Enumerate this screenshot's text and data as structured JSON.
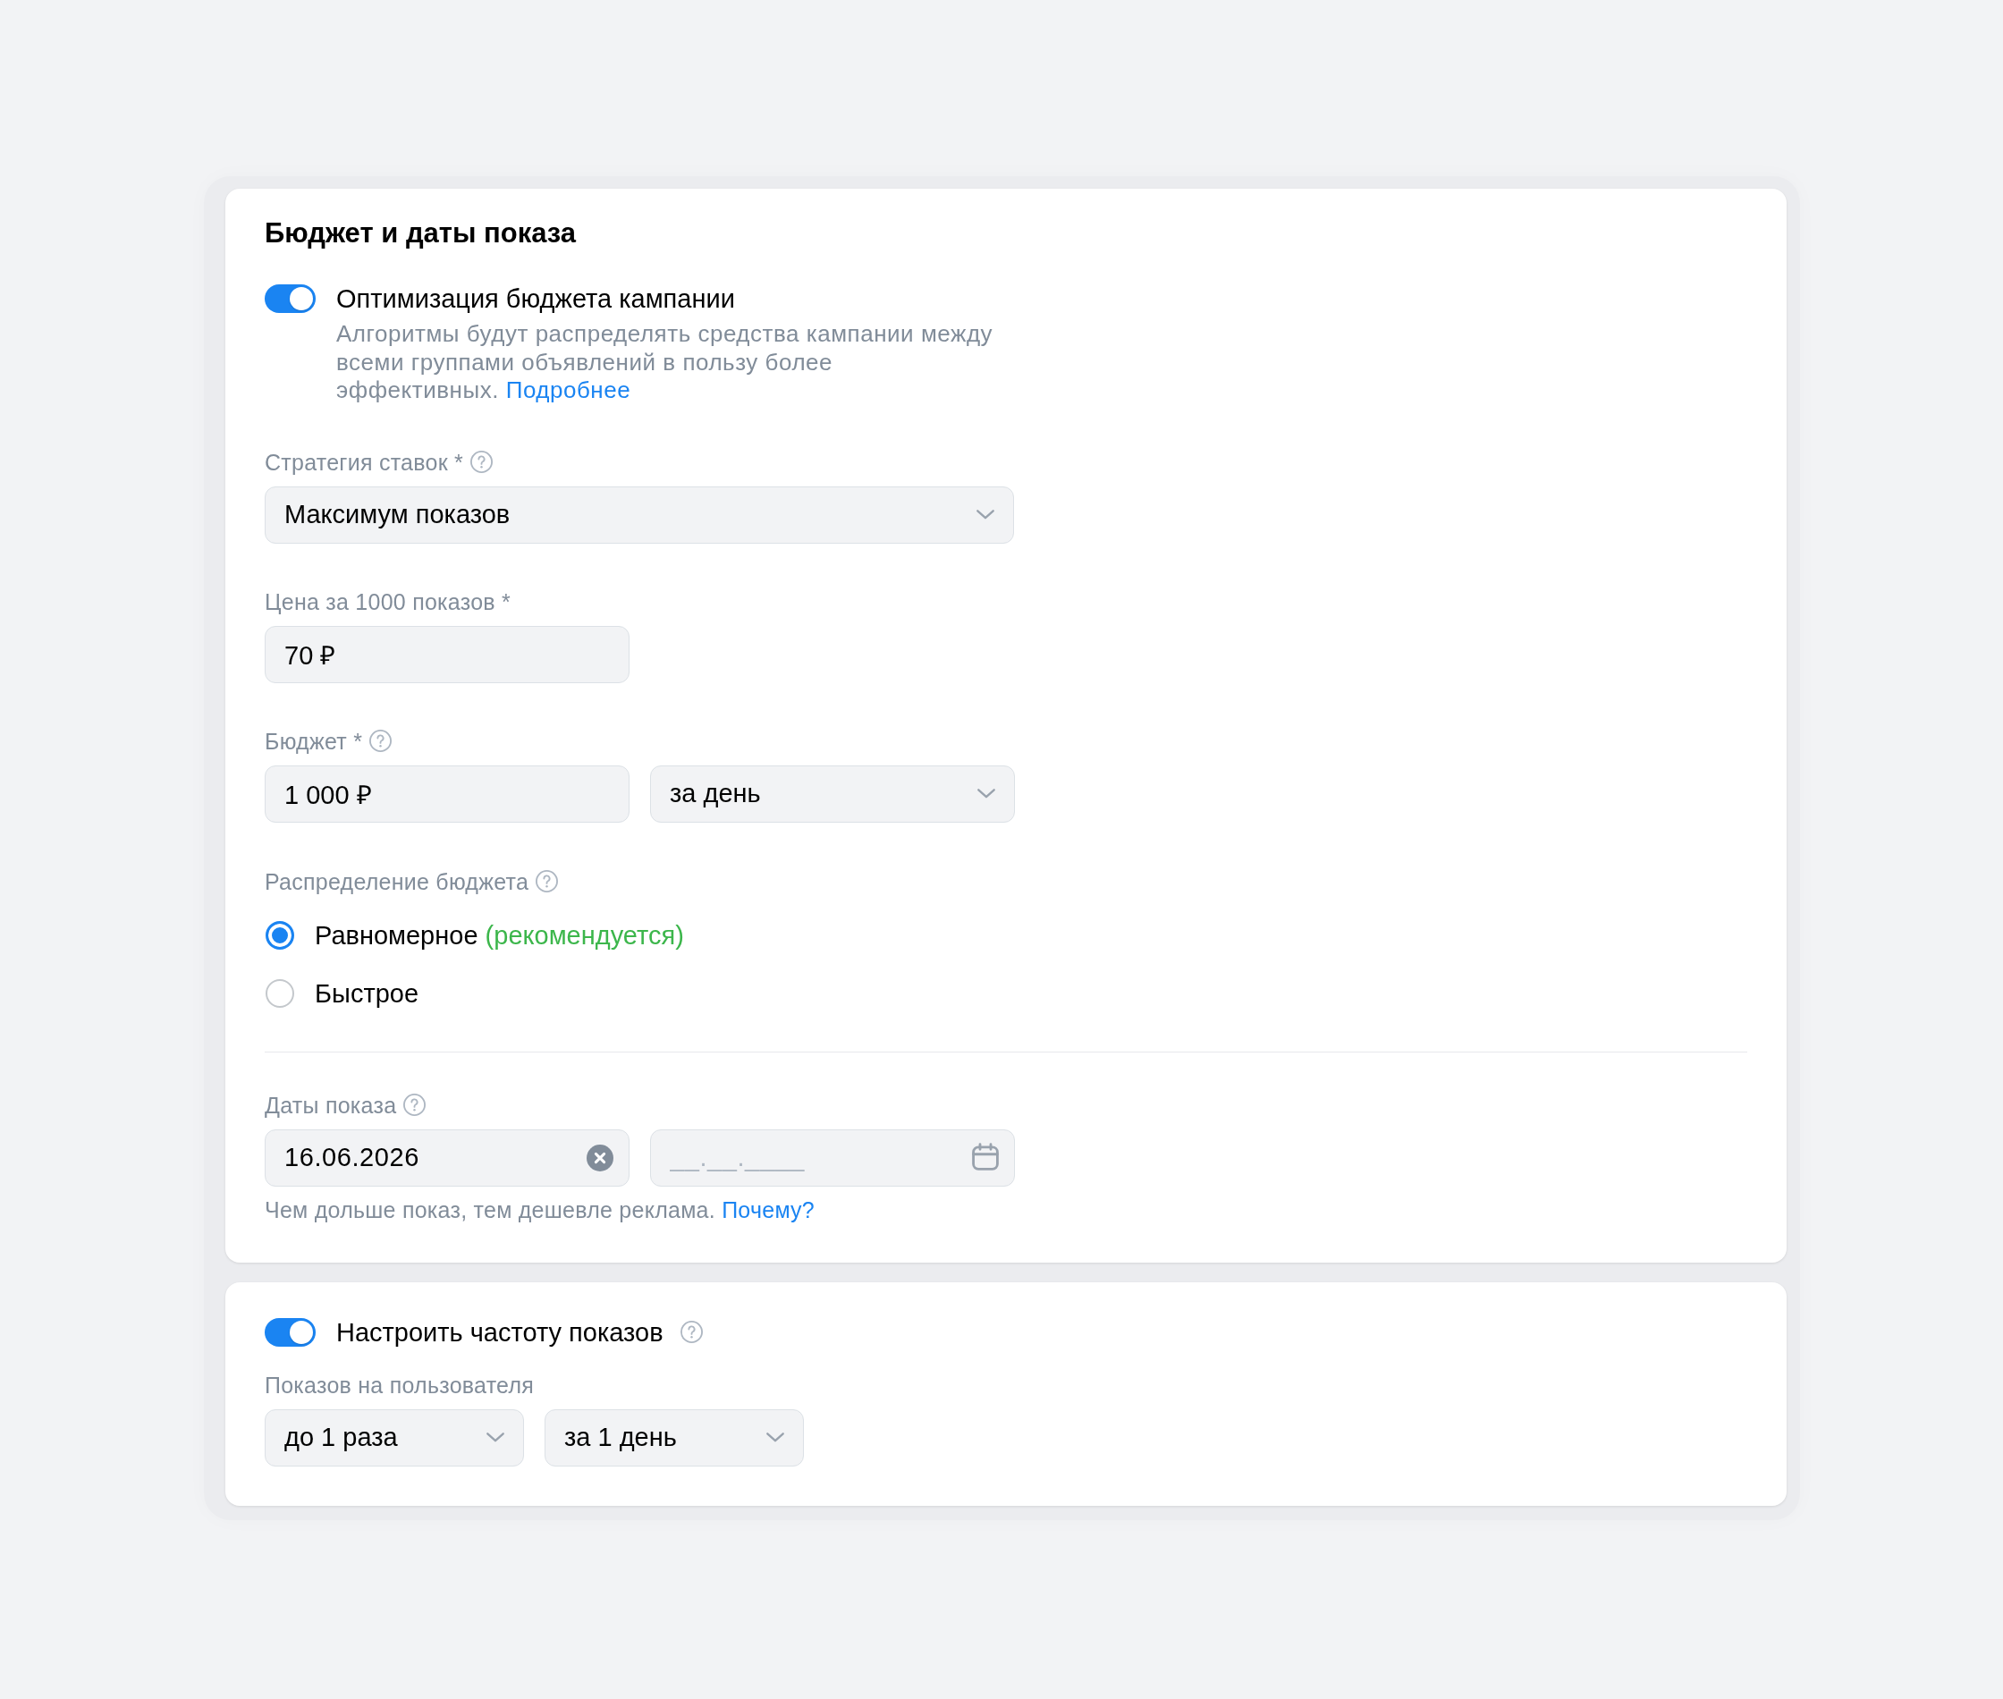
{
  "budget_card": {
    "title": "Бюджет и даты показа",
    "optimization": {
      "label": "Оптимизация бюджета кампании",
      "on": true,
      "description": "Алгоритмы будут распределять средства кампании между всеми группами объявлений в пользу более эффективных.",
      "link": "Подробнее"
    },
    "bid_strategy": {
      "label": "Стратегия ставок *",
      "help": true,
      "value": "Максимум показов"
    },
    "price": {
      "label": "Цена за 1000 показов *",
      "help": false,
      "value": "70 ₽"
    },
    "budget": {
      "label": "Бюджет *",
      "help": true,
      "value": "1 000 ₽",
      "period": "за день"
    },
    "distribution": {
      "label": "Распределение бюджета",
      "help": true,
      "options": [
        {
          "label": "Равномерное",
          "note": "(рекомендуется)",
          "selected": true
        },
        {
          "label": "Быстрое",
          "selected": false
        }
      ]
    },
    "dates": {
      "label": "Даты показа",
      "help": true,
      "start": {
        "value": "16.06.2026"
      },
      "end": {
        "placeholder": "__.__.____"
      },
      "hint": "Чем дольше показ, тем дешевле реклама.",
      "hint_link": "Почему?"
    }
  },
  "frequency_card": {
    "toggle": {
      "label": "Настроить частоту показов",
      "on": true,
      "help": true
    },
    "label": "Показов на пользователя",
    "selects": [
      {
        "value": "до 1 раза"
      },
      {
        "value": "за 1 день"
      }
    ]
  }
}
